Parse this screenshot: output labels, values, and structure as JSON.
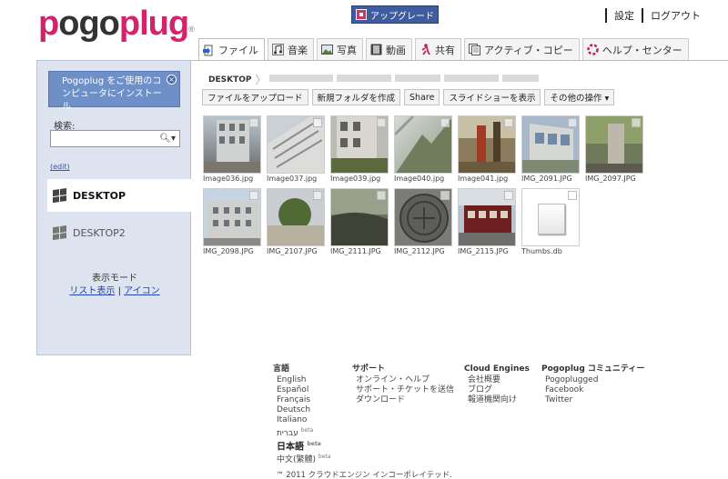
{
  "brand": {
    "logo_p": "p",
    "logo_o": "o",
    "logo_rest1": "go",
    "logo_rest2": "plug",
    "reg": "®"
  },
  "header": {
    "upgrade": "アップグレード",
    "settings": "設定",
    "logout": "ログアウト"
  },
  "tabs": [
    {
      "label": "ファイル",
      "icon": "file-icon"
    },
    {
      "label": "音楽",
      "icon": "music-icon"
    },
    {
      "label": "写真",
      "icon": "photo-icon"
    },
    {
      "label": "動画",
      "icon": "video-icon"
    },
    {
      "label": "共有",
      "icon": "share-icon"
    },
    {
      "label": "アクティブ・コピー",
      "icon": "copy-icon"
    },
    {
      "label": "ヘルプ・センター",
      "icon": "help-icon"
    }
  ],
  "sidebar": {
    "install": "Pogoplug をご使用のコンピュータにインストール",
    "search_label": "検索:",
    "search_placeholder": "",
    "edit": "(edit)",
    "devices": [
      "DESKTOP",
      "DESKTOP2"
    ],
    "mode_label": "表示モード",
    "mode_list": "リスト表示",
    "mode_sep": "|",
    "mode_icon": "アイコン"
  },
  "breadcrumb": {
    "root": "DESKTOP"
  },
  "actions": [
    "ファイルをアップロード",
    "新規フォルダを作成",
    "Share",
    "スライドショーを表示",
    "その他の操作 ▾"
  ],
  "files": [
    "Image036.jpg",
    "Image037.jpg",
    "Image039.jpg",
    "Image040.jpg",
    "Image041.jpg",
    "IMG_2091.JPG",
    "IMG_2097.JPG",
    "IMG_2098.JPG",
    "IMG_2107.JPG",
    "IMG_2111.JPG",
    "IMG_2112.JPG",
    "IMG_2115.JPG",
    "Thumbs.db"
  ],
  "footer": {
    "lang_head": "言語",
    "langs": [
      "English",
      "Español",
      "Français",
      "Deutsch",
      "Italiano",
      "עברית",
      "日本語",
      "中文(繁體)"
    ],
    "beta": "beta",
    "support_head": "サポート",
    "support": [
      "オンライン・ヘルプ",
      "サポート・チケットを送信",
      "ダウンロード"
    ],
    "ce_head": "Cloud Engines",
    "ce": [
      "会社概要",
      "ブログ",
      "報道機関向け"
    ],
    "comm_head": "Pogoplug コミュニティー",
    "comm": [
      "Pogoplugged",
      "Facebook",
      "Twitter"
    ],
    "copyright": "™ 2011 クラウドエンジン インコーポレイテッド."
  },
  "colors": {
    "brand_pink": "#d2236d",
    "upgrade_blue": "#3f5c9e",
    "sidebar_bg": "#dde3ef",
    "install_blue": "#6f8fc7"
  }
}
